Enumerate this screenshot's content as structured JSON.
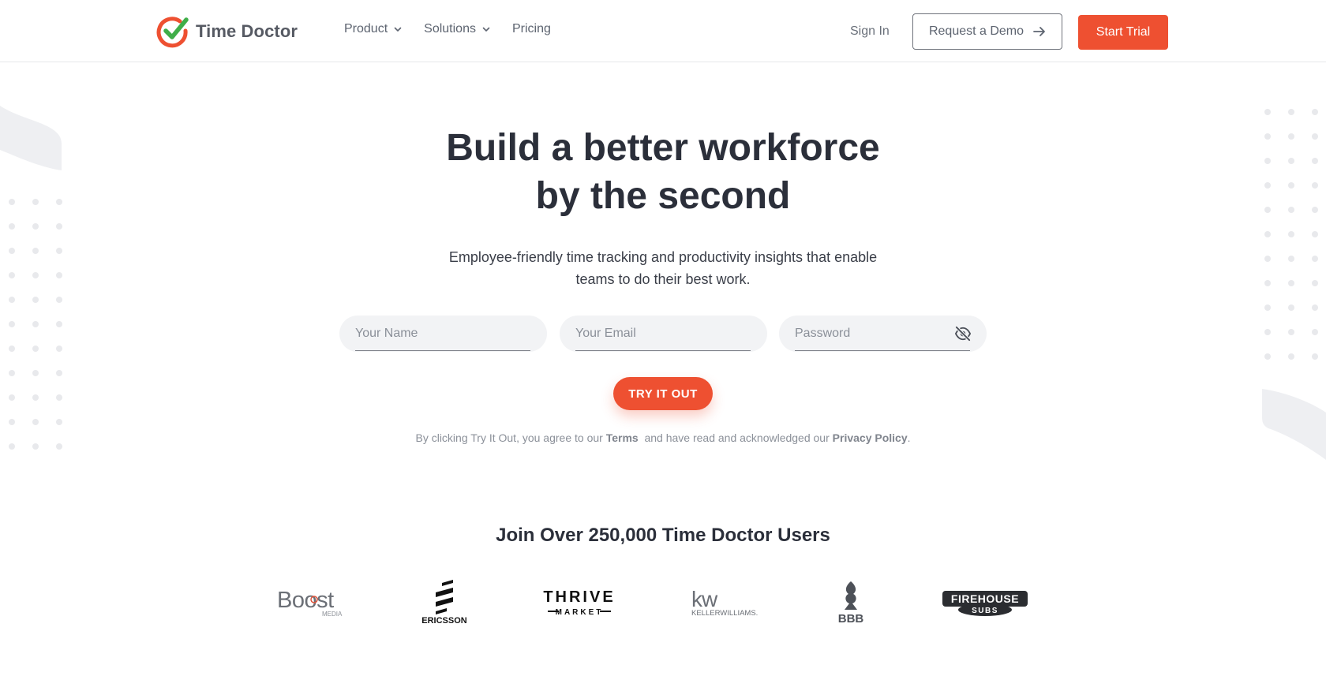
{
  "header": {
    "logo_text": "Time Doctor",
    "nav": [
      {
        "label": "Product",
        "has_dropdown": true
      },
      {
        "label": "Solutions",
        "has_dropdown": true
      },
      {
        "label": "Pricing",
        "has_dropdown": false
      }
    ],
    "signin_label": "Sign In",
    "demo_label": "Request a Demo",
    "trial_label": "Start Trial"
  },
  "hero": {
    "title_line1": "Build a better workforce",
    "title_line2": "by the second",
    "subtitle_line1": "Employee-friendly time tracking and productivity insights that enable",
    "subtitle_line2": "teams to do their best work."
  },
  "form": {
    "name_placeholder": "Your Name",
    "email_placeholder": "Your Email",
    "password_placeholder": "Password",
    "submit_label": "TRY IT OUT",
    "legal_prefix": "By clicking Try It Out, you agree to our ",
    "terms_label": "Terms",
    "legal_middle": "  and have read and acknowledged our ",
    "privacy_label": "Privacy Policy",
    "legal_suffix": "."
  },
  "social_proof": {
    "heading": "Join Over 250,000 Time Doctor Users",
    "brands": [
      "Boost Media",
      "Ericsson",
      "Thrive Market",
      "Keller Williams",
      "BBB",
      "Firehouse Subs"
    ]
  },
  "colors": {
    "accent": "#ee5031",
    "logo_green": "#3fae49",
    "text_dark": "#2b2f3a",
    "field_bg": "#f2f3f5"
  }
}
